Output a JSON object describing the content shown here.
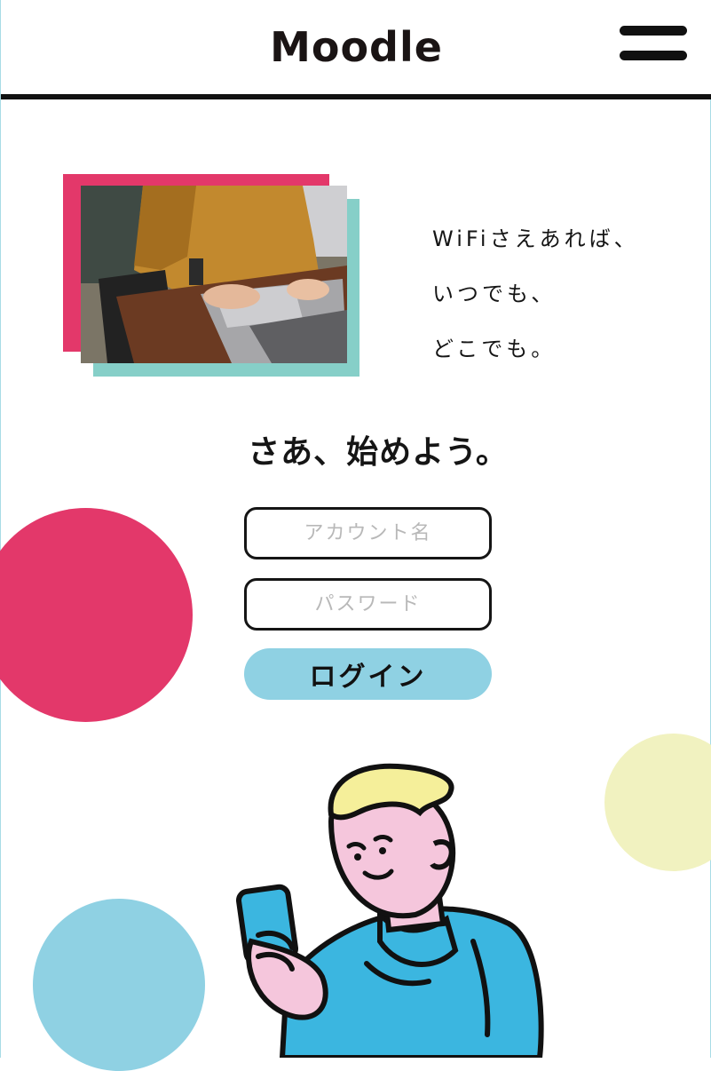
{
  "header": {
    "logo": "Moodle",
    "menu_icon": "hamburger-menu-icon"
  },
  "hero": {
    "photo_description_icon": "laptop-photo",
    "tagline": [
      "WiFiさえあれば、",
      "いつでも、",
      "どこでも。"
    ]
  },
  "login": {
    "headline": "さあ、始めよう。",
    "account_placeholder": "アカウント名",
    "account_value": "",
    "password_placeholder": "パスワード",
    "password_value": "",
    "login_label": "ログイン"
  },
  "colors": {
    "accent_red": "#e3386a",
    "accent_teal": "#86cfc8",
    "accent_blue": "#8fd1e3",
    "accent_yellow": "#f1f2c0",
    "text": "#151515"
  }
}
